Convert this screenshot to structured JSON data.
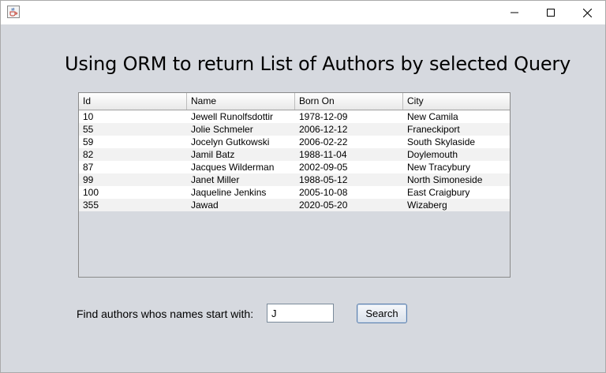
{
  "window": {
    "controls": {
      "minimize_icon": "minimize-icon",
      "maximize_icon": "maximize-icon",
      "close_icon": "close-icon"
    },
    "app_icon": "java-cup-icon"
  },
  "main": {
    "heading": "Using ORM to return List of Authors by selected Query"
  },
  "table": {
    "columns": [
      "Id",
      "Name",
      "Born On",
      "City"
    ],
    "rows": [
      [
        "10",
        "Jewell Runolfsdottir",
        "1978-12-09",
        "New Camila"
      ],
      [
        "55",
        "Jolie Schmeler",
        "2006-12-12",
        "Franeckiport"
      ],
      [
        "59",
        "Jocelyn Gutkowski",
        "2006-02-22",
        "South Skylaside"
      ],
      [
        "82",
        "Jamil Batz",
        "1988-11-04",
        "Doylemouth"
      ],
      [
        "87",
        "Jacques Wilderman",
        "2002-09-05",
        "New Tracybury"
      ],
      [
        "99",
        "Janet Miller",
        "1988-05-12",
        "North Simoneside"
      ],
      [
        "100",
        "Jaqueline Jenkins",
        "2005-10-08",
        "East Craigbury"
      ],
      [
        "355",
        "Jawad",
        "2020-05-20",
        "Wizaberg"
      ]
    ]
  },
  "search": {
    "label": "Find authors whos names start with:",
    "value": "J",
    "button_label": "Search"
  }
}
